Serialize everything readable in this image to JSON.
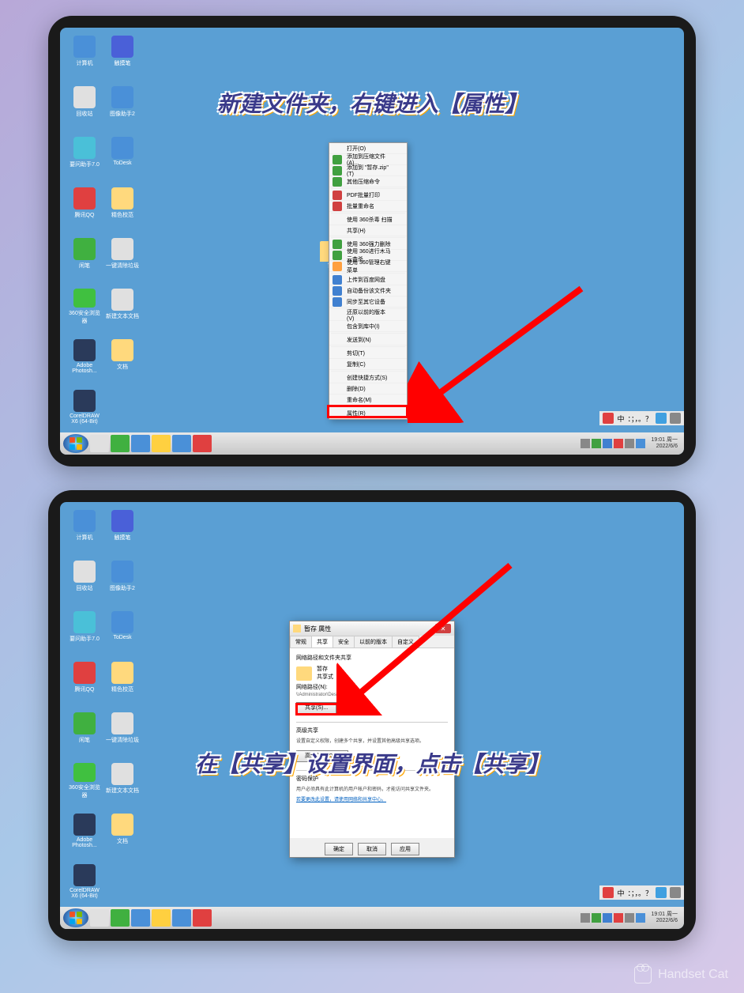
{
  "instruction1": "新建文件夹，右键进入【属性】",
  "instruction2": "在【共享】设置界面，点击【共享】",
  "desktop_icons": [
    {
      "label": "计算机",
      "color": "#4a90d8"
    },
    {
      "label": "触摸笔",
      "color": "#4a60d8"
    },
    {
      "label": "回收站",
      "color": "#e0e0e0"
    },
    {
      "label": "图像助手2",
      "color": "#4a90d8"
    },
    {
      "label": "要问助手7.0",
      "color": "#4ac0d8"
    },
    {
      "label": "ToDesk",
      "color": "#4a90d8"
    },
    {
      "label": "腾讯QQ",
      "color": "#e04040"
    },
    {
      "label": "精色校范",
      "color": "#ffd97d"
    },
    {
      "label": "闲笔",
      "color": "#40b040"
    },
    {
      "label": "一键清除垃圾",
      "color": "#e0e0e0"
    },
    {
      "label": "360安全浏览器",
      "color": "#40c040"
    },
    {
      "label": "新建文本文档",
      "color": "#e0e0e0"
    },
    {
      "label": "Adobe Photosh...",
      "color": "#2a3a5a"
    },
    {
      "label": "文档",
      "color": "#ffd97d"
    },
    {
      "label": "CorelDRAW X6 (64-Bit)",
      "color": "#2a3a5a"
    }
  ],
  "context_menu": [
    {
      "label": "打开(O)",
      "icon": null
    },
    {
      "label": "添加到压缩文件(A)...",
      "icon": "#40a040"
    },
    {
      "label": "添加到 \"暂存.zip\"(T)",
      "icon": "#40a040"
    },
    {
      "label": "其他压缩命令",
      "icon": "#40a040"
    },
    {
      "sep": true
    },
    {
      "label": "PDF批量打印",
      "icon": "#d04040"
    },
    {
      "label": "批量重命名",
      "icon": "#d04040"
    },
    {
      "sep": true
    },
    {
      "label": "使用 360杀毒 扫描",
      "icon": null
    },
    {
      "label": "共享(H)",
      "icon": null
    },
    {
      "sep": true
    },
    {
      "label": "使用 360强力删除",
      "icon": "#40a040"
    },
    {
      "label": "使用 360进行木马云查杀",
      "icon": "#40a040"
    },
    {
      "label": "使用 360管理右键菜单",
      "icon": "#ffa040"
    },
    {
      "sep": true
    },
    {
      "label": "上传到百度网盘",
      "icon": "#4080d0"
    },
    {
      "label": "自动备份该文件夹",
      "icon": "#4080d0"
    },
    {
      "label": "同步至其它设备",
      "icon": "#4080d0"
    },
    {
      "sep": true
    },
    {
      "label": "还原以前的版本(V)",
      "icon": null
    },
    {
      "label": "包含到库中(I)",
      "icon": null
    },
    {
      "sep": true
    },
    {
      "label": "发送到(N)",
      "icon": null
    },
    {
      "sep": true
    },
    {
      "label": "剪切(T)",
      "icon": null
    },
    {
      "label": "复制(C)",
      "icon": null
    },
    {
      "sep": true
    },
    {
      "label": "创建快捷方式(S)",
      "icon": null
    },
    {
      "label": "删除(D)",
      "icon": null
    },
    {
      "label": "重命名(M)",
      "icon": null
    },
    {
      "sep": true
    },
    {
      "label": "属性(R)",
      "icon": null
    }
  ],
  "dialog": {
    "title": "暂存 属性",
    "tabs": [
      "常规",
      "共享",
      "安全",
      "以前的版本",
      "自定义"
    ],
    "active_tab": "共享",
    "section1_title": "网络路径和文件夹共享",
    "folder_name": "暂存",
    "folder_status": "共享式",
    "path_label": "网络路径(N):",
    "path_value": "\\\\Administrator\\Desktop\\暂存",
    "share_btn": "共享(S)...",
    "section2_title": "高级共享",
    "section2_desc": "设置自定义权限，创建多个共享，并设置其他高级共享选项。",
    "adv_btn": "高级共享(D)...",
    "section3_title": "密码保护",
    "section3_desc": "用户必须具有此计算机的用户帐户和密码，才能访问共享文件夹。",
    "section3_link": "若要更改此设置，请使用网络和共享中心。",
    "ok": "确定",
    "cancel": "取消",
    "apply": "应用"
  },
  "lang_bar": {
    "ime": "中",
    "symbols": "：；，。？"
  },
  "clock": {
    "time": "19:01 周一",
    "date": "2022/6/6"
  },
  "taskbar_items": [
    {
      "color": "#e0e0e0"
    },
    {
      "color": "#40b040"
    },
    {
      "color": "#4a90d8"
    },
    {
      "color": "#ffd040"
    },
    {
      "color": "#4a90d8"
    },
    {
      "color": "#e04040"
    }
  ],
  "watermark": "Handset Cat"
}
